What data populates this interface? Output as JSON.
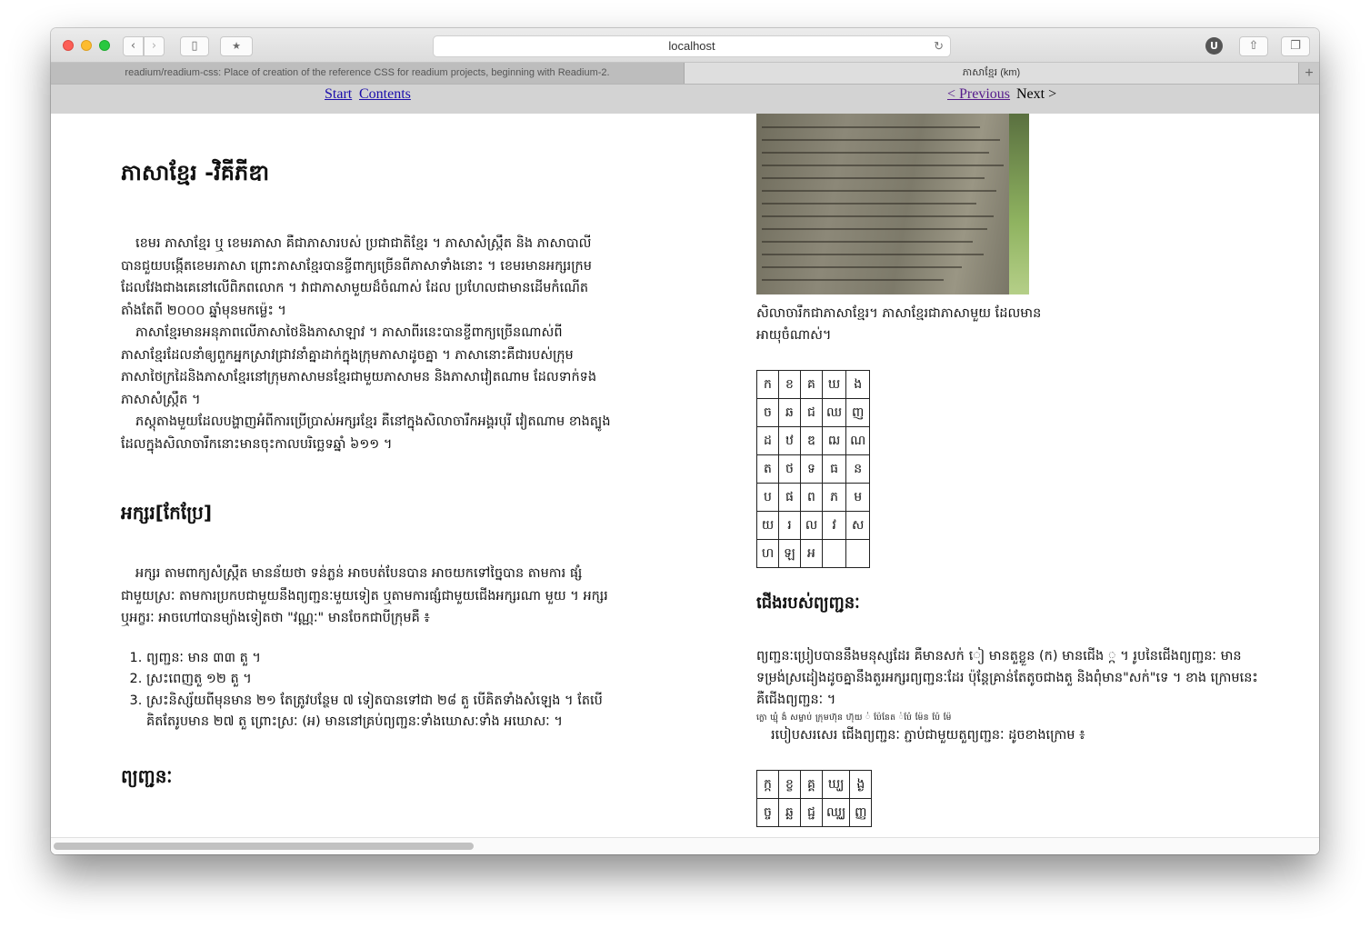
{
  "browser": {
    "url": "localhost",
    "ext_badge": "U",
    "tabs": [
      {
        "title": "readium/readium-css: Place of creation of the reference CSS for readium projects, beginning with Readium-2.",
        "active": false
      },
      {
        "title": "ភាសាខ្មែរ (km)",
        "active": true
      }
    ],
    "new_tab": "+"
  },
  "icons": {
    "back": "chevron-left-icon",
    "forward": "chevron-right-icon",
    "sidebar": "sidebar-icon",
    "bookmark": "star-icon",
    "reload": "reload-icon",
    "share": "share-icon",
    "tabs": "tabs-icon"
  },
  "nav": {
    "start": "Start",
    "contents": "Contents",
    "previous": "< Previous",
    "next": "Next >"
  },
  "doc": {
    "title": "ភាសាខ្មែរ -វិគីភីឌា",
    "intro": [
      "ខេមរ ភាសាខ្មែរ ឬ ខេមរភាសា គឺជាភាសារបស់ ប្រជាជាតិខ្មែរ ។ ភាសាសំស្ក្រឹត និង ភាសាបាលីបានជួយបង្កើតខេមរភាសា ព្រោះភាសាខ្មែរបានខ្ចីពាក្យច្រើនពីភាសាទាំងនោះ ។ ខេមរមានអក្សរក្រមដែលវែងជាងគេនៅលើពិភពលោក ។ វាជាភាសាមួយដ៏ចំណាស់ ដែល ប្រហែលជាមានដើមកំណើតតាំងតែពី ២០០០ ឆ្នាំមុនមកម្ល៉េះ ។",
      "ភាសាខ្មែរមានអនុភាពលើភាសាថៃនិងភាសាឡាវ ។ ភាសាពីរនេះបានខ្ចីពាក្យច្រើនណាស់ពី ភាសាខ្មែរដែលនាំឲ្យពួកអ្នកស្រាវជ្រាវនាំគ្នាដាក់ក្នុងក្រុមភាសាដូចគ្នា ។ ភាសានោះគឺជារបស់ក្រុម ភាសាថៃក្រដៃនិងភាសាខ្មែរនៅក្រុមភាសាមនខ្មែរជាមួយភាសាមន និងភាសាវៀតណាម ដែលទាក់ទងភាសាសំស្ក្រឹត ។",
      "ភស្តុតាងមួយដែលបង្ហាញអំពីការប្រើប្រាស់អក្សរខ្មែរ គឺនៅក្នុងសិលាចារឹកអង្គរបុរី វៀតណាម ខាងត្បូងដែលក្នុងសិលាចារឹកនោះមានចុះកាលបរិច្ឆេទឆ្នាំ ៦១១ ។"
    ],
    "letters_heading": "អក្សរ[កែប្រែ]",
    "letters_para": "អក្សរ តាមពាក្យសំស្ក្រឹត មានន័យថា ទន់ភ្លន់ អាចបត់បែនបាន អាចយកទៅច្នៃបាន តាមការ ផ្សំជាមួយស្រៈ តាមការប្រកបជាមួយនឹងព្យញ្ជនៈមួយទៀត ឬតាមការផ្សំជាមួយជើងអក្សរណា មួយ ។ អក្សរ ឬអក្ខរៈ អាចហៅបានម្យ៉ាងទៀតថា \"វណ្ណៈ\" មានចែកជាបីក្រុមគឺ ៖",
    "letters_list": [
      "ព្យញ្ជនៈ មាន ៣៣ តួ ។",
      "ស្រះពេញតួ ១២ តួ ។",
      "ស្រះនិស្ស័យពីមុនមាន ២១ តែត្រូវបន្ថែម ៧ ទៀតបានទៅជា ២៨ តួ បើគិតទាំងសំឡេង ។ តែបើគិតតែរូបមាន ២៧ តួ ព្រោះស្រៈ (អ) មាននៅគ្រប់ព្យញ្ជនៈទាំងឃោសៈទាំង អឃោសៈ ។"
    ],
    "consonants_heading": "ព្យញ្ជនៈ",
    "caption": "សិលាចារឹកជាភាសាខ្មែរ។ ភាសាខ្មែរជាភាសាមួយ ដែលមានអាយុចំណាស់។",
    "consonant_table": [
      [
        "ក",
        "ខ",
        "គ",
        "ឃ",
        "ង"
      ],
      [
        "ច",
        "ឆ",
        "ជ",
        "ឈ",
        "ញ"
      ],
      [
        "ដ",
        "ឋ",
        "ឌ",
        "ឍ",
        "ណ"
      ],
      [
        "ត",
        "ថ",
        "ទ",
        "ធ",
        "ន"
      ],
      [
        "ប",
        "ផ",
        "ព",
        "ភ",
        "ម"
      ],
      [
        "យ",
        "រ",
        "ល",
        "វ",
        "ស"
      ],
      [
        "ហ",
        "ឡ",
        "អ",
        "",
        ""
      ]
    ],
    "feet_heading": "ជើងរបស់ព្យញ្ជនៈ",
    "feet_para": "ព្យញ្ជនៈប្រៀបបាននឹងមនុស្សដែរ គឺមានសក់ ៀ មានតួខ្លួន (ក) មានជើង ្ក ។ រូបនៃជើងព្យញ្ជនៈ មានទម្រង់ស្រដៀងដូចគ្នានឹងតួរអក្សរព្យញ្ជនៈដែរ ប៉ុន្តែគ្រាន់តែតូចជាងតួ និងពុំមាន\"សក់\"ទេ ។ ខាង ក្រោមនេះ គឺជើងព្យញ្ជនៈ ។",
    "feet_tiny": "ក្លោ ឃ្មុំ ងំ សម្លាប់ ក្រុមហ៊ុន ហ៊ុយ ់ ប៉ែនែត ់ប៉ែ ម៉ែន ប៉ែ ម៉ែ",
    "feet_para2": "របៀបសរសេរ ជើងព្យញ្ជនៈ ភ្ជាប់ជាមួយតួព្យញ្ជនៈ ដូចខាងក្រោម ៖",
    "feet_table": [
      [
        "ក្ក",
        "ខ្ខ",
        "គ្គ",
        "ឃ្ឃ",
        "ង្ង"
      ],
      [
        "ច្ច",
        "ឆ្ឆ",
        "ជ្ជ",
        "ឈ្ឈ",
        "ញ្ញ"
      ]
    ]
  }
}
